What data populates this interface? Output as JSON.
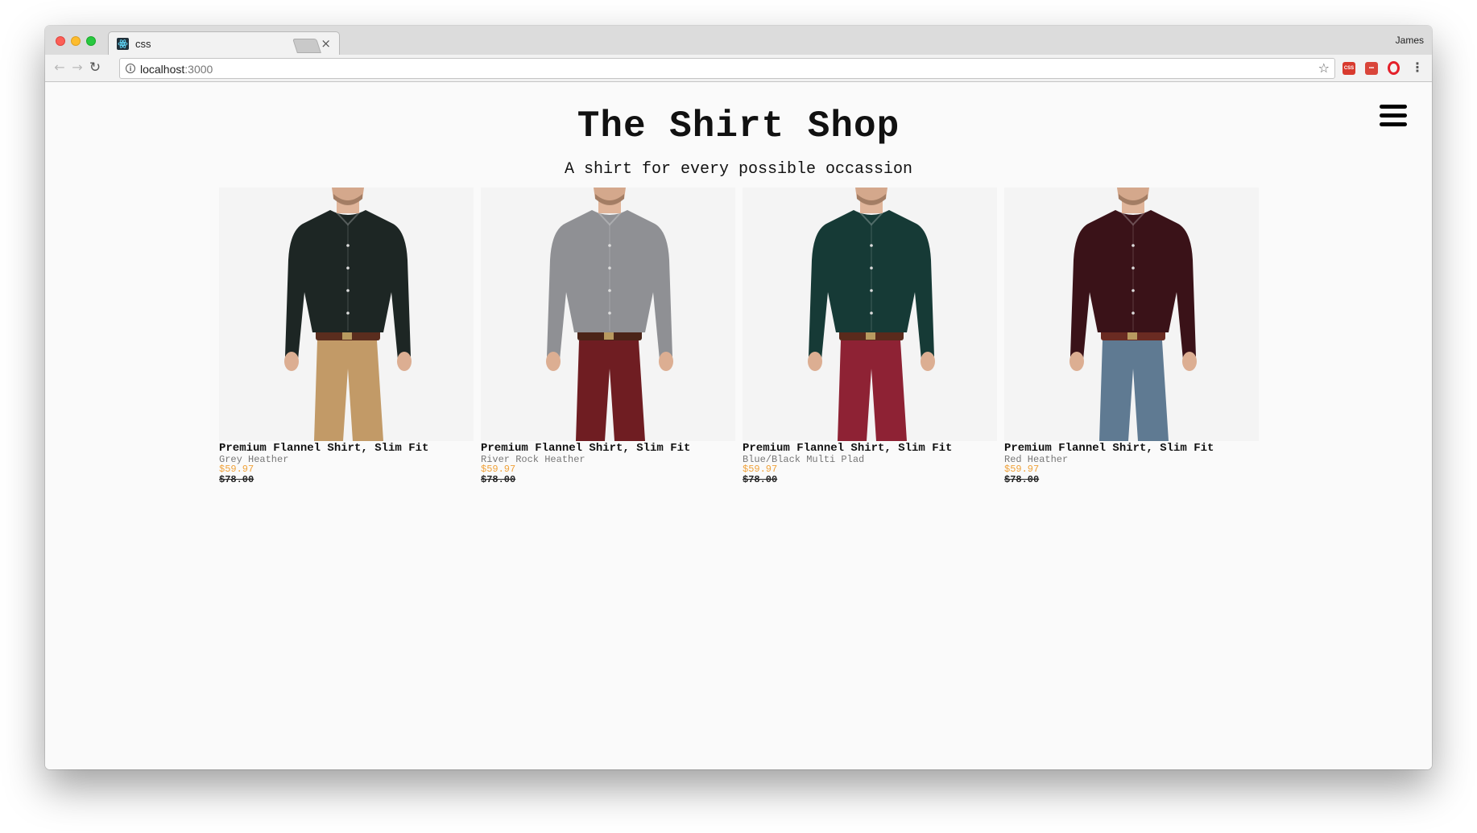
{
  "browser": {
    "tab_title": "css",
    "tab_close": "×",
    "profile_name": "James",
    "url_host": "localhost",
    "url_port": ":3000",
    "extensions": [
      "css-ext-icon",
      "red-ext-icon",
      "opera-icon"
    ],
    "icons": {
      "back": "←",
      "forward": "→",
      "reload": "↻",
      "info": "i",
      "star": "☆",
      "menu": "⋮"
    }
  },
  "site": {
    "title": "The Shirt Shop",
    "subtitle": "A shirt for every possible occassion"
  },
  "products": [
    {
      "name": "Premium Flannel Shirt, Slim Fit",
      "color": "Grey Heather",
      "sale_price": "$59.97",
      "original_price": "$78.00",
      "shirt_hex": "#1d2624",
      "pants_hex": "#c29a67",
      "belt_hex": "#5a2d1e"
    },
    {
      "name": "Premium Flannel Shirt, Slim Fit",
      "color": "River Rock Heather",
      "sale_price": "$59.97",
      "original_price": "$78.00",
      "shirt_hex": "#8f9094",
      "pants_hex": "#6f1d22",
      "belt_hex": "#4b2418"
    },
    {
      "name": "Premium Flannel Shirt, Slim Fit",
      "color": "Blue/Black Multi Plad",
      "sale_price": "$59.97",
      "original_price": "$78.00",
      "shirt_hex": "#163a36",
      "pants_hex": "#8e2234",
      "belt_hex": "#5a2a1c"
    },
    {
      "name": "Premium Flannel Shirt, Slim Fit",
      "color": "Red Heather",
      "sale_price": "$59.97",
      "original_price": "$78.00",
      "shirt_hex": "#3a1218",
      "pants_hex": "#5f7a92",
      "belt_hex": "#6a2b22"
    }
  ],
  "colors": {
    "sale_price": "#f0a23a",
    "page_bg": "#fafafa"
  }
}
